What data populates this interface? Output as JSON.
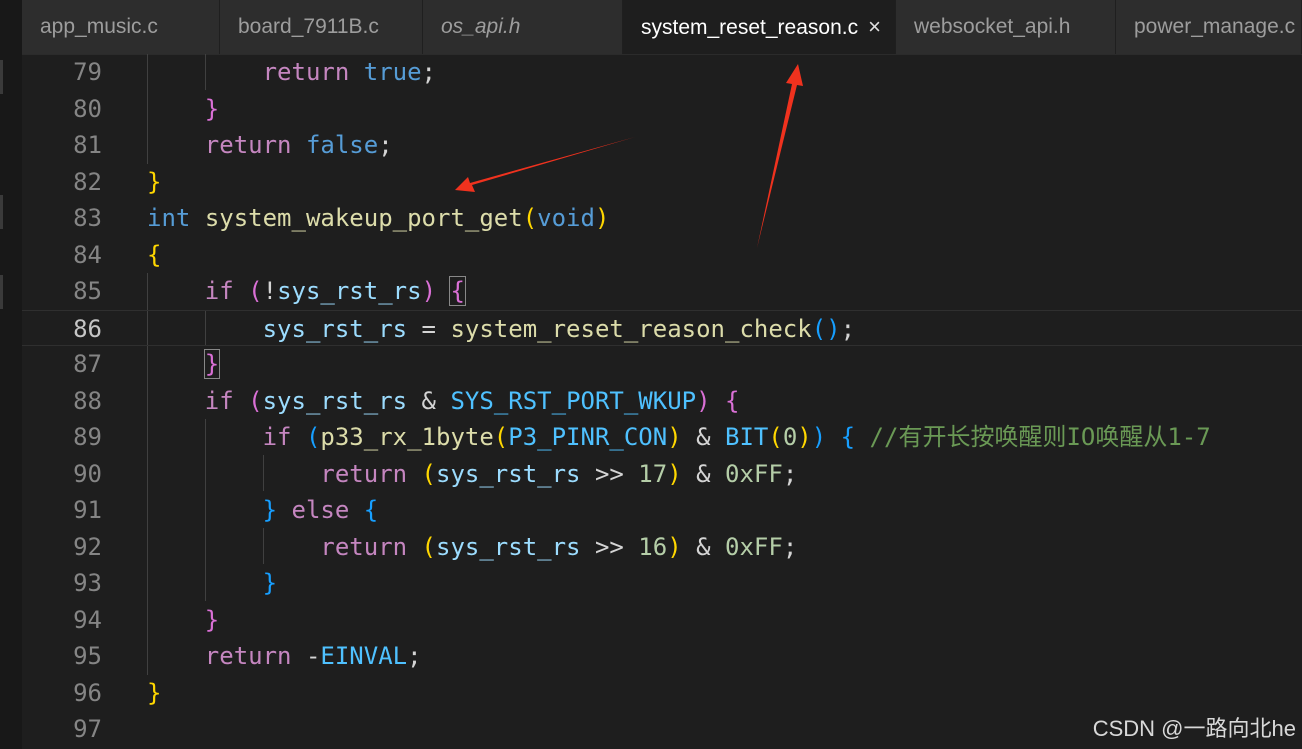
{
  "tabs": [
    {
      "label": "app_music.c"
    },
    {
      "label": "board_7911B.c"
    },
    {
      "label": "os_api.h"
    },
    {
      "label": "system_reset_reason.c",
      "close": "×"
    },
    {
      "label": "websocket_api.h"
    },
    {
      "label": "power_manage.c"
    }
  ],
  "lines": [
    {
      "n": "79"
    },
    {
      "n": "80"
    },
    {
      "n": "81"
    },
    {
      "n": "82"
    },
    {
      "n": "83"
    },
    {
      "n": "84"
    },
    {
      "n": "85"
    },
    {
      "n": "86"
    },
    {
      "n": "87"
    },
    {
      "n": "88"
    },
    {
      "n": "89"
    },
    {
      "n": "90"
    },
    {
      "n": "91"
    },
    {
      "n": "92"
    },
    {
      "n": "93"
    },
    {
      "n": "94"
    },
    {
      "n": "95"
    },
    {
      "n": "96"
    },
    {
      "n": "97"
    }
  ],
  "code": {
    "l79": {
      "return": "return",
      "true": "true",
      "semi": ";"
    },
    "l80": {
      "brace": "}"
    },
    "l81": {
      "return": "return",
      "false": "false",
      "semi": ";"
    },
    "l82": {
      "brace": "}"
    },
    "l83": {
      "int": "int",
      "fn": "system_wakeup_port_get",
      "lp": "(",
      "void": "void",
      "rp": ")"
    },
    "l84": {
      "brace": "{"
    },
    "l85": {
      "if": "if",
      "lp": "(",
      "not": "!",
      "var": "sys_rst_rs",
      "rp": ")",
      "brace": "{"
    },
    "l86": {
      "var": "sys_rst_rs",
      "eq": " = ",
      "fn": "system_reset_reason_check",
      "lp": "(",
      "rp": ")",
      "semi": ";"
    },
    "l87": {
      "brace": "}"
    },
    "l88": {
      "if": "if",
      "lp": "(",
      "var": "sys_rst_rs",
      "amp": " & ",
      "mac": "SYS_RST_PORT_WKUP",
      "rp": ")",
      "brace": "{"
    },
    "l89": {
      "if": "if",
      "lp": "(",
      "fn": "p33_rx_1byte",
      "lp2": "(",
      "mac": "P3_PINR_CON",
      "rp2": ")",
      "amp": " & ",
      "fn2": "BIT",
      "lp3": "(",
      "num": "0",
      "rp3": ")",
      "rp": ")",
      "brace": "{",
      "comment": "//有开长按唤醒则IO唤醒从1-7"
    },
    "l90": {
      "return": "return",
      "lp": "(",
      "var": "sys_rst_rs",
      "op": " >> ",
      "num": "17",
      "rp": ")",
      "amp": " & ",
      "hex": "0xFF",
      "semi": ";"
    },
    "l91": {
      "rbrace": "}",
      "else": "else",
      "lbrace": "{"
    },
    "l92": {
      "return": "return",
      "lp": "(",
      "var": "sys_rst_rs",
      "op": " >> ",
      "num": "16",
      "rp": ")",
      "amp": " & ",
      "hex": "0xFF",
      "semi": ";"
    },
    "l93": {
      "brace": "}"
    },
    "l94": {
      "brace": "}"
    },
    "l95": {
      "return": "return",
      "minus": "-",
      "mac": "EINVAL",
      "semi": ";"
    },
    "l96": {
      "brace": "}"
    }
  },
  "watermark": "CSDN @一路向北he",
  "annotation_color": "#f0321e"
}
